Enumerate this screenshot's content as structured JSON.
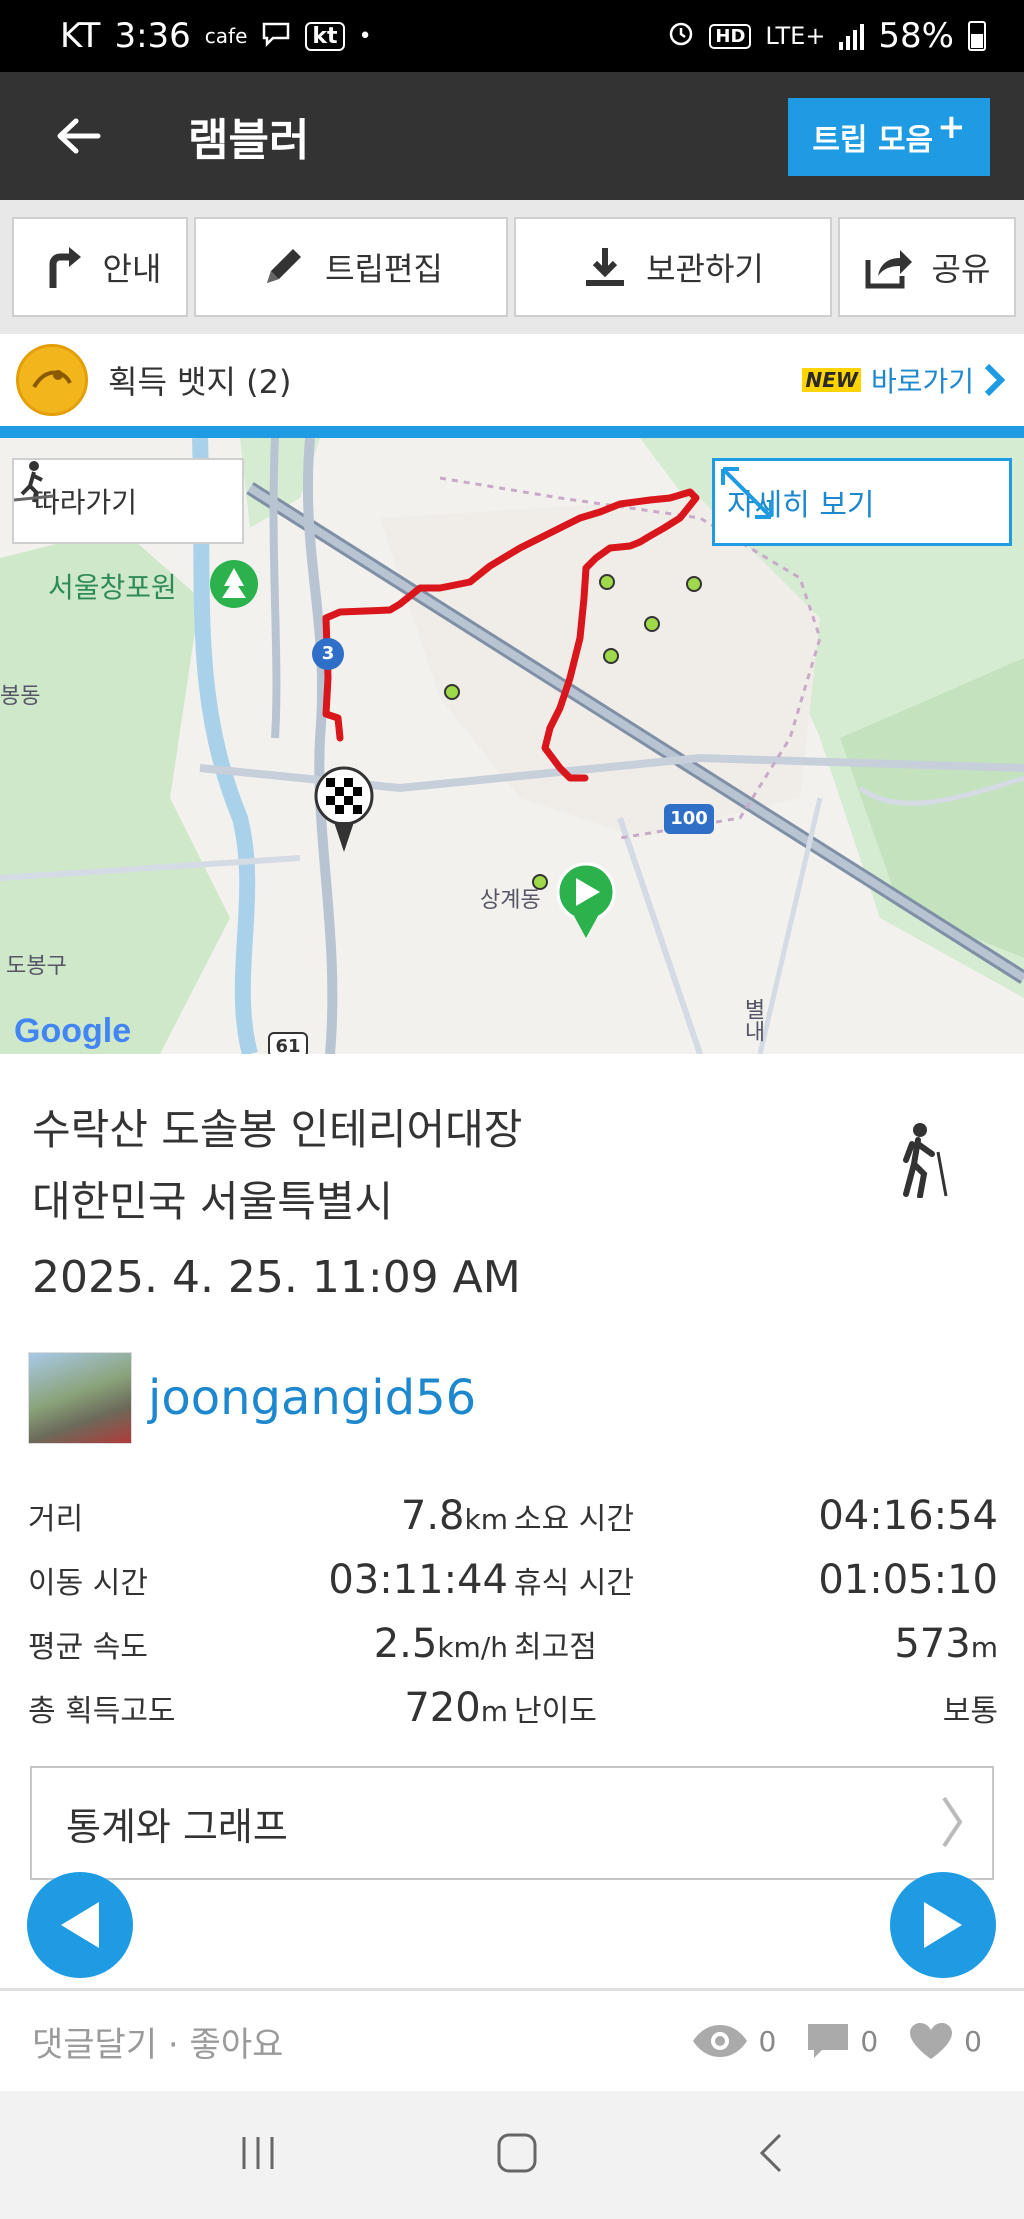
{
  "status_bar": {
    "carrier": "KT",
    "time": "3:36",
    "cafe": "cafe",
    "kt_badge": "kt",
    "dot": "•",
    "hd": "HD",
    "lte": "LTE+",
    "battery": "58%"
  },
  "header": {
    "title": "램블러",
    "trip_button": "트립 모음",
    "trip_button_plus": "+"
  },
  "toolbar": {
    "guide": "안내",
    "edit": "트립편집",
    "save": "보관하기",
    "share": "공유"
  },
  "badge_bar": {
    "label": "획득 뱃지 (2)",
    "new_tag": "NEW",
    "shortcut": "바로가기"
  },
  "map": {
    "follow_button": "따라가기",
    "detail_button": "자세히 보기",
    "place_label": "서울창포원",
    "sanggye_label": "상계동",
    "dobong_label": "도봉구",
    "left_label": "봉동",
    "route_3": "3",
    "route_100": "100",
    "route_61": "61",
    "google": "Google",
    "right_label": "별내"
  },
  "trip": {
    "title": "수락산 도솔봉 인테리어대장",
    "location": "대한민국 서울특별시",
    "datetime": "2025. 4. 25. 11:09 AM",
    "username": "joongangid56"
  },
  "stats": {
    "distance_label": "거리",
    "distance_value": "7.8",
    "distance_unit": "km",
    "duration_label": "소요 시간",
    "duration_value": "04:16:54",
    "moving_label": "이동 시간",
    "moving_value": "03:11:44",
    "rest_label": "휴식 시간",
    "rest_value": "01:05:10",
    "avg_speed_label": "평균 속도",
    "avg_speed_value": "2.5",
    "avg_speed_unit": "km/h",
    "highest_label": "최고점",
    "highest_value": "573",
    "highest_unit": "m",
    "gain_label": "총 획득고도",
    "gain_value": "720",
    "gain_unit": "m",
    "difficulty_label": "난이도",
    "difficulty_value": "보통"
  },
  "graph_link": "통계와 그래프",
  "comment_bar": {
    "text": "댓글달기 · 좋아요",
    "views": "0",
    "comments": "0",
    "likes": "0"
  },
  "colors": {
    "accent": "#1e9be3",
    "header_bg": "#333333",
    "route": "#d9161c"
  }
}
